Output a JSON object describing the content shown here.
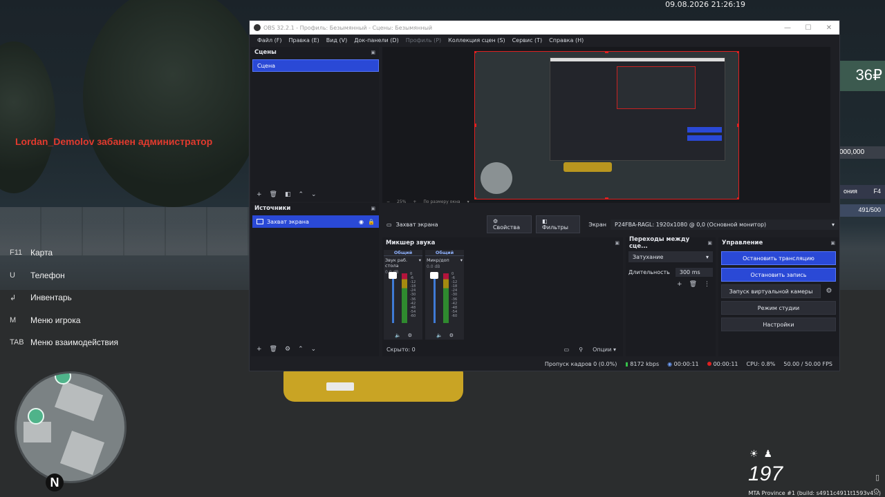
{
  "game": {
    "timestamp": "09.08.2026 21:26:19",
    "ban_message": "Lordan_Demolov забанен администратор",
    "hotkeys": [
      {
        "key": "F11",
        "label": "Карта"
      },
      {
        "key": "U",
        "label": "Телефон"
      },
      {
        "key": "",
        "label": "Инвентарь"
      },
      {
        "key": "M",
        "label": "Меню игрока"
      },
      {
        "key": "TAB",
        "label": "Меню взаимодействия"
      }
    ],
    "money": "36₽",
    "money2": "000,000",
    "f4_label": "ония",
    "f4_key": "F4",
    "hp": "491/500",
    "speed": "197",
    "compass": "N",
    "build": "MTA Province #1 (build: s4911c4911t1593v4...)"
  },
  "obs": {
    "title": "OBS 32.2.1 - Профиль: Безымянный - Сцены: Безымянный",
    "menu": [
      "Файл (F)",
      "Правка (E)",
      "Вид (V)",
      "Док-панели (D)",
      "Профиль (P)",
      "Коллекция сцен (S)",
      "Сервис (T)",
      "Справка (H)"
    ],
    "scenes": {
      "title": "Сцены",
      "items": [
        "Сцена"
      ]
    },
    "sources": {
      "title": "Источники",
      "items": [
        "Захват экрана"
      ]
    },
    "preview": {
      "zoom": "25%",
      "fit": "По размеру окна"
    },
    "context": {
      "source": "Захват экрана",
      "props": "Свойства",
      "filters": "Фильтры",
      "screen_label": "Экран",
      "screen_value": "P24FBA-RAGL: 1920x1080 @ 0,0 (Основной монитор)"
    },
    "mixer": {
      "title": "Микшер звука",
      "channels": [
        {
          "head": "Общий",
          "name": "Звук раб. стола",
          "db": "0.0 dB"
        },
        {
          "head": "Общий",
          "name": "Микр/доп",
          "db": "0.0 dB"
        }
      ],
      "scale": [
        "0",
        "-6",
        "-12",
        "-18",
        "-24",
        "-30",
        "-36",
        "-42",
        "-48",
        "-54",
        "-60"
      ],
      "hidden": "Скрыто: 0",
      "options": "Опции"
    },
    "transitions": {
      "title": "Переходы между сце...",
      "selected": "Затухание",
      "duration_label": "Длительность",
      "duration": "300 ms"
    },
    "controls": {
      "title": "Управление",
      "stop_stream": "Остановить трансляцию",
      "stop_record": "Остановить запись",
      "virtual_cam": "Запуск виртуальной камеры",
      "studio": "Режим студии",
      "settings": "Настройки"
    },
    "status": {
      "dropped": "Пропуск кадров 0 (0.0%)",
      "bitrate": "8172 kbps",
      "stream_time": "00:00:11",
      "rec_time": "00:00:11",
      "cpu": "CPU: 0.8%",
      "fps": "50.00 / 50.00 FPS"
    }
  }
}
